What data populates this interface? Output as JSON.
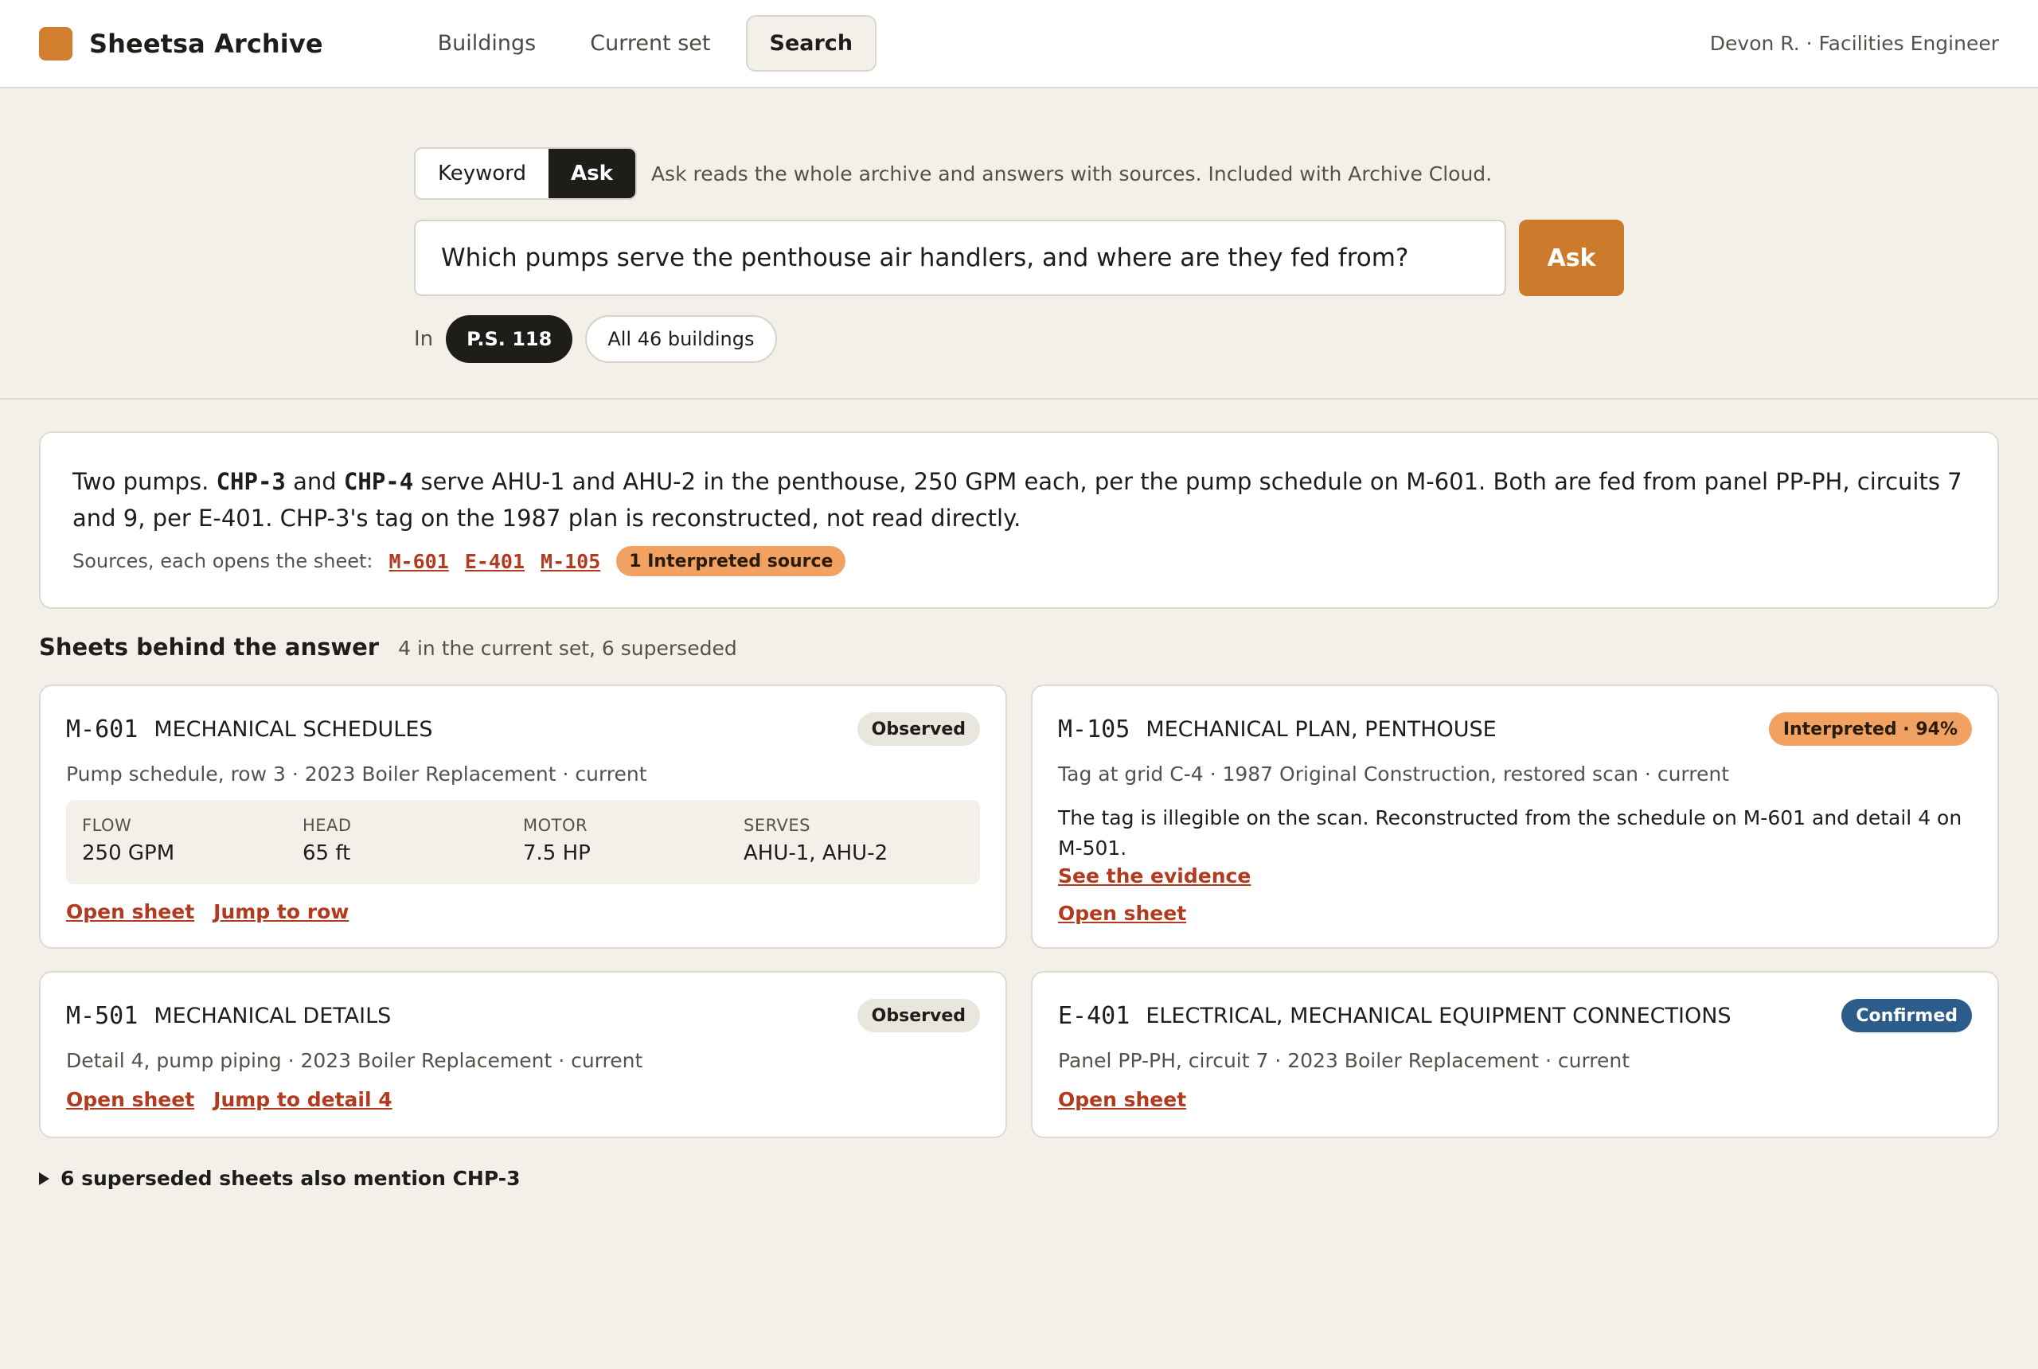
{
  "app": {
    "name": "Sheetsa Archive"
  },
  "nav": {
    "items": [
      {
        "label": "Buildings"
      },
      {
        "label": "Current set"
      },
      {
        "label": "Search"
      }
    ]
  },
  "user": {
    "label": "Devon R. · Facilities Engineer"
  },
  "search": {
    "modes": [
      {
        "label": "Keyword"
      },
      {
        "label": "Ask"
      }
    ],
    "mode_note": "Ask reads the whole archive and answers with sources. Included with Archive Cloud.",
    "query": "Which pumps serve the penthouse air handlers, and where are they fed from?",
    "ask_label": "Ask",
    "scope_label": "In",
    "scopes": [
      {
        "label": "P.S. 118"
      },
      {
        "label": "All 46 buildings"
      }
    ]
  },
  "answer": {
    "p1": "Two pumps.",
    "tag1": "CHP-3",
    "p2": "and",
    "tag2": "CHP-4",
    "p3": "serve AHU-1 and AHU-2 in the penthouse, 250 GPM each, per the pump schedule on M-601. Both are fed from panel PP-PH, circuits 7 and 9, per E-401. CHP-3's tag on the 1987 plan is reconstructed, not read directly.",
    "sources_label": "Sources, each opens the sheet:",
    "sources": [
      "M-601",
      "E-401",
      "M-105"
    ],
    "interpreted_badge": "1 Interpreted source"
  },
  "section": {
    "title": "Sheets behind the answer",
    "sub": "4 in the current set, 6 superseded"
  },
  "cards": [
    {
      "code": "M-601",
      "title": "MECHANICAL SCHEDULES",
      "status": "Observed",
      "meta": "Pump schedule, row 3 · 2023 Boiler Replacement · current",
      "props": [
        {
          "label": "FLOW",
          "value": "250 GPM"
        },
        {
          "label": "HEAD",
          "value": "65 ft"
        },
        {
          "label": "MOTOR",
          "value": "7.5 HP"
        },
        {
          "label": "SERVES",
          "value": "AHU-1, AHU-2"
        }
      ],
      "links": [
        "Open sheet",
        "Jump to row"
      ]
    },
    {
      "code": "M-105",
      "title": "MECHANICAL PLAN, PENTHOUSE",
      "status": "Interpreted · 94%",
      "meta": "Tag at grid C-4 · 1987 Original Construction, restored scan · current",
      "desc": "The tag is illegible on the scan. Reconstructed from the schedule on M-601 and detail 4 on M-501.",
      "evidence": "See the evidence",
      "links": [
        "Open sheet"
      ]
    },
    {
      "code": "M-501",
      "title": "MECHANICAL DETAILS",
      "status": "Observed",
      "meta": "Detail 4, pump piping · 2023 Boiler Replacement · current",
      "links": [
        "Open sheet",
        "Jump to detail 4"
      ]
    },
    {
      "code": "E-401",
      "title": "ELECTRICAL, MECHANICAL EQUIPMENT CONNECTIONS",
      "status": "Confirmed",
      "meta": "Panel PP-PH, circuit 7 · 2023 Boiler Replacement · current",
      "links": [
        "Open sheet"
      ]
    }
  ],
  "superseded": {
    "label": "6 superseded sheets also mention CHP-3"
  },
  "colors": {
    "accent": "#cc7a2c",
    "link": "#b23a1f",
    "interpreted": "#f1a161",
    "confirmed": "#2c5d8a"
  }
}
